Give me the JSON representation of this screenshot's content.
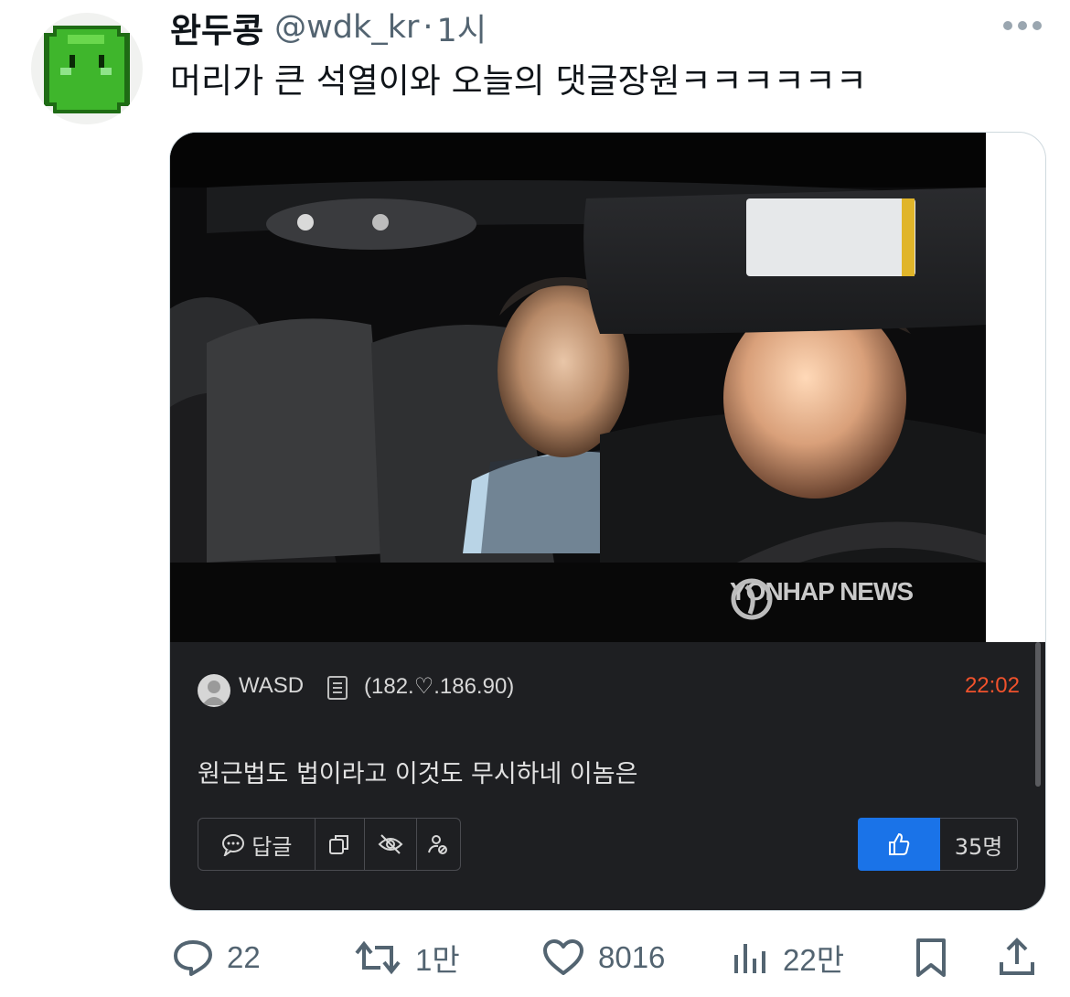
{
  "tweet": {
    "display_name": "완두콩",
    "handle": "@wdk_kr",
    "separator": "·",
    "time": "1시",
    "text": "머리가 큰 석열이와 오늘의 댓글장원ㅋㅋㅋㅋㅋㅋ",
    "avatar_icon": "pixel-pea-face-icon",
    "more_icon": "more-horizontal-icon"
  },
  "media": {
    "watermark": "YONHAP NEWS",
    "comment": {
      "username": "WASD",
      "ip": "(182.♡.186.90)",
      "time": "22:02",
      "time_color": "#f0522c",
      "body": "원근법도 법이라고 이것도 무시하네 이놈은",
      "reply_label": "답글",
      "like_count": "35명",
      "like_color": "#1a73e8"
    }
  },
  "stats": {
    "replies": "22",
    "reposts": "1만",
    "likes": "8016",
    "views": "22만"
  }
}
